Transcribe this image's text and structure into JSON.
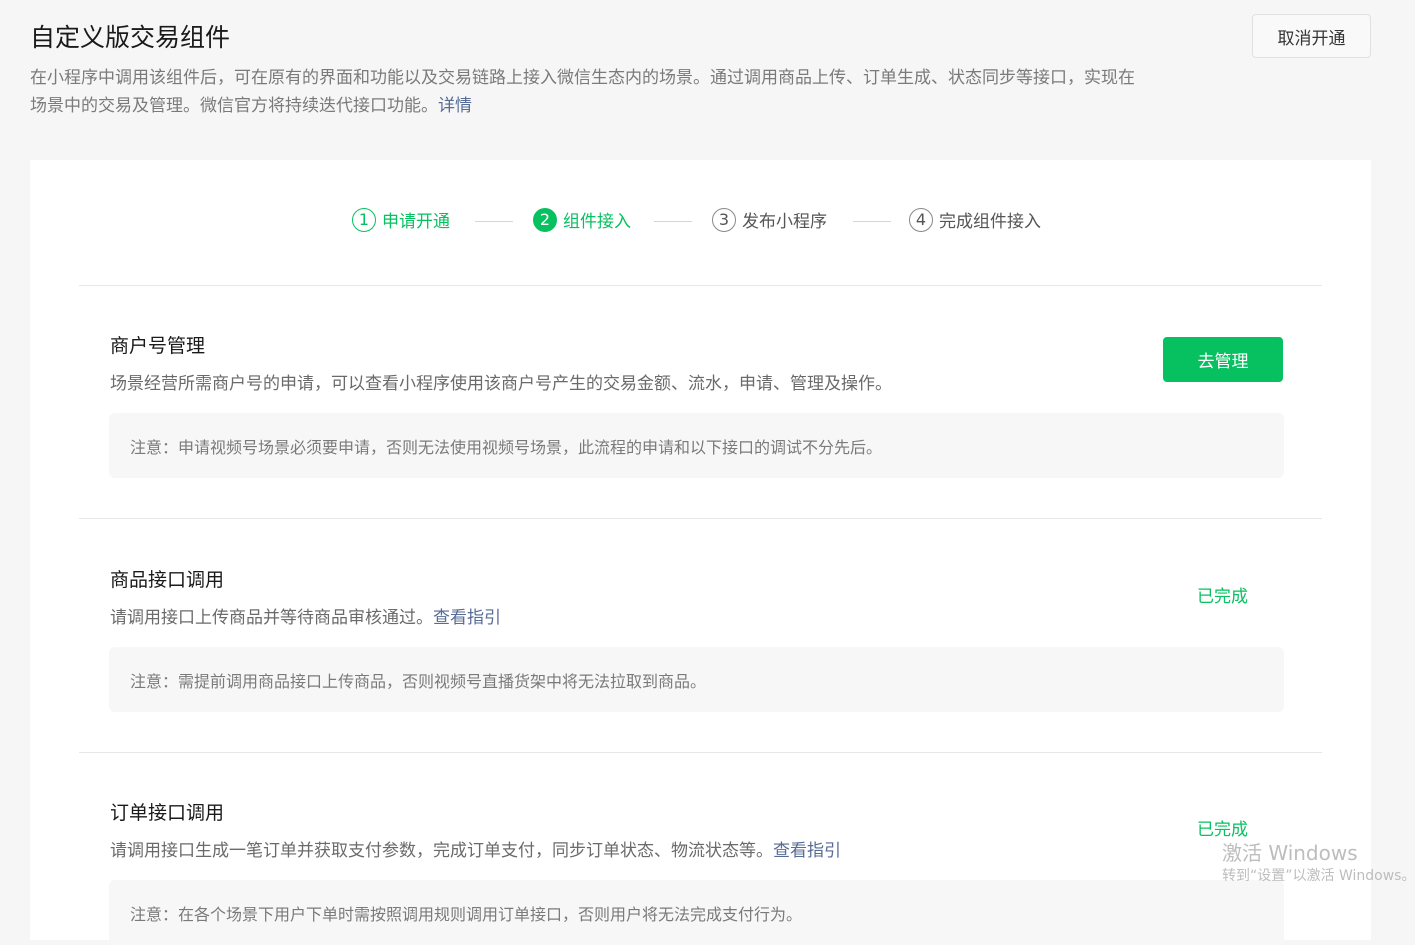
{
  "header": {
    "title": "自定义版交易组件",
    "description": "在小程序中调用该组件后，可在原有的界面和功能以及交易链路上接入微信生态内的场景。通过调用商品上传、订单生成、状态同步等接口，实现在场景中的交易及管理。微信官方将持续迭代接口功能。",
    "details_link": "详情",
    "cancel_button": "取消开通"
  },
  "steps": [
    {
      "number": "1",
      "label": "申请开通",
      "state": "done"
    },
    {
      "number": "2",
      "label": "组件接入",
      "state": "current"
    },
    {
      "number": "3",
      "label": "发布小程序",
      "state": "pending"
    },
    {
      "number": "4",
      "label": "完成组件接入",
      "state": "pending"
    }
  ],
  "sections": [
    {
      "title": "商户号管理",
      "description": "场景经营所需商户号的申请，可以查看小程序使用该商户号产生的交易金额、流水，申请、管理及操作。",
      "note": "注意：申请视频号场景必须要申请，否则无法使用视频号场景，此流程的申请和以下接口的调试不分先后。",
      "action_button": "去管理"
    },
    {
      "title": "商品接口调用",
      "description": "请调用接口上传商品并等待商品审核通过。",
      "guide_link": "查看指引",
      "note": "注意：需提前调用商品接口上传商品，否则视频号直播货架中将无法拉取到商品。",
      "status": "已完成"
    },
    {
      "title": "订单接口调用",
      "description": "请调用接口生成一笔订单并获取支付参数，完成订单支付，同步订单状态、物流状态等。",
      "guide_link": "查看指引",
      "note": "注意：在各个场景下用户下单时需按照调用规则调用订单接口，否则用户将无法完成支付行为。",
      "status": "已完成"
    }
  ],
  "watermark": {
    "title": "激活 Windows",
    "subtitle": "转到“设置”以激活 Windows。"
  },
  "colors": {
    "brand_green": "#07c160",
    "link_blue": "#576b95"
  }
}
